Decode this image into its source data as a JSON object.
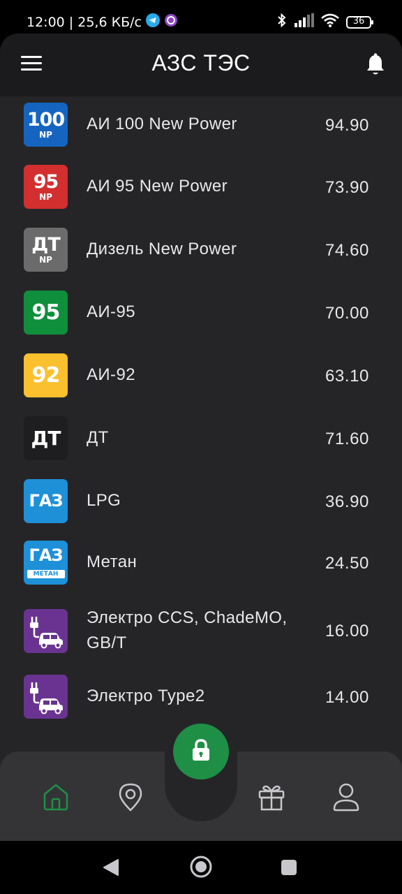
{
  "status_bar": {
    "time_speed": "12:00 | 25,6 КБ/с",
    "battery": "36"
  },
  "header": {
    "title": "АЗС ТЭС"
  },
  "fuels": [
    {
      "badge": "100",
      "badge_sub": "NP",
      "name": "АИ 100 New Power",
      "price": "94.90",
      "color": "#1565c0"
    },
    {
      "badge": "95",
      "badge_sub": "NP",
      "name": "АИ 95 New Power",
      "price": "73.90",
      "color": "#d32f2f"
    },
    {
      "badge": "ДТ",
      "badge_sub": "NP",
      "name": "Дизель New Power",
      "price": "74.60",
      "color": "#6b6b6b"
    },
    {
      "badge": "95",
      "badge_sub": "",
      "name": "АИ-95",
      "price": "70.00",
      "color": "#0f8f3c"
    },
    {
      "badge": "92",
      "badge_sub": "",
      "name": "АИ-92",
      "price": "63.10",
      "color": "#fbc02d"
    },
    {
      "badge": "ДТ",
      "badge_sub": "",
      "name": "ДТ",
      "price": "71.60",
      "color": "#1e1e20"
    },
    {
      "badge": "ГАЗ",
      "badge_sub": "",
      "name": "LPG",
      "price": "36.90",
      "color": "#1e90d8"
    },
    {
      "badge": "ГАЗ",
      "badge_sub": "МЕТАН",
      "name": "Метан",
      "price": "24.50",
      "color": "#1e90d8"
    },
    {
      "badge": "",
      "badge_sub": "",
      "name": "Электро CCS, ChadeMO, GB/T",
      "price": "16.00",
      "color": "#6a3391"
    },
    {
      "badge": "",
      "badge_sub": "",
      "name": "Электро Type2",
      "price": "14.00",
      "color": "#6a3391"
    }
  ],
  "colors": {
    "accent": "#1f8f46",
    "background": "#252528",
    "topbar": "#1b1b1e",
    "bottom_nav": "#343437"
  },
  "nav": {
    "items": [
      "home-icon",
      "map-pin-icon",
      "lock-icon",
      "gift-icon",
      "user-icon"
    ],
    "active": "home-icon"
  }
}
